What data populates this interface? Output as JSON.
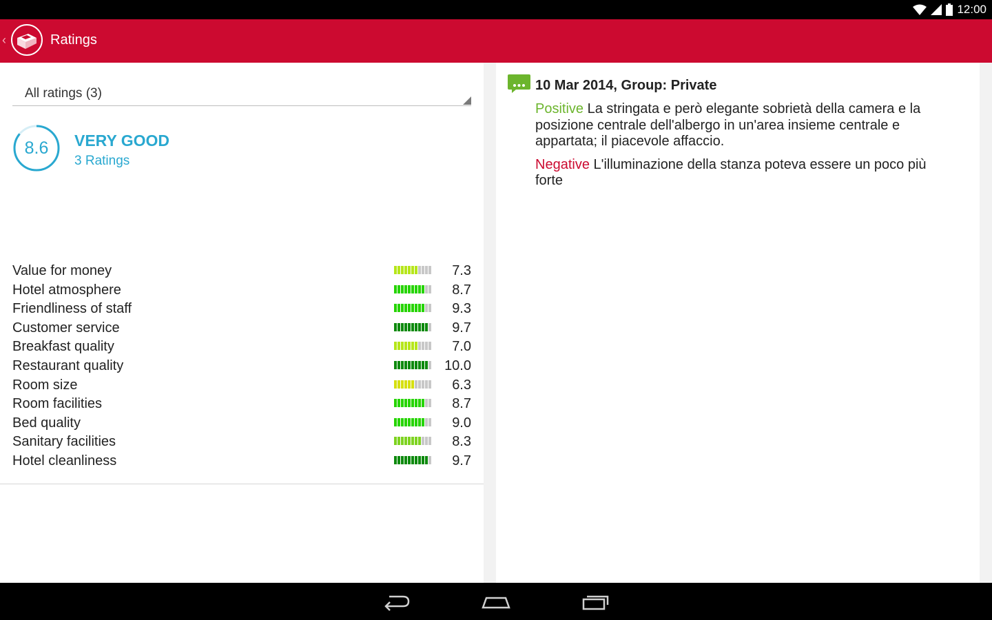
{
  "status_bar": {
    "time": "12:00"
  },
  "app_bar": {
    "title": "Ratings"
  },
  "filter": {
    "selected": "All ratings (3)"
  },
  "summary": {
    "score": "8.6",
    "score_fraction": 0.86,
    "verdict": "VERY GOOD",
    "count_label": "3 Ratings"
  },
  "criteria": [
    {
      "label": "Value for money",
      "value": "7.3"
    },
    {
      "label": "Hotel atmosphere",
      "value": "8.7"
    },
    {
      "label": "Friendliness of staff",
      "value": "9.3"
    },
    {
      "label": "Customer service",
      "value": "9.7"
    },
    {
      "label": "Breakfast quality",
      "value": "7.0"
    },
    {
      "label": "Restaurant quality",
      "value": "10.0"
    },
    {
      "label": "Room size",
      "value": "6.3"
    },
    {
      "label": "Room facilities",
      "value": "8.7"
    },
    {
      "label": "Bed quality",
      "value": "9.0"
    },
    {
      "label": "Sanitary facilities",
      "value": "8.3"
    },
    {
      "label": "Hotel cleanliness",
      "value": "9.7"
    }
  ],
  "review": {
    "header": "10 Mar 2014, Group: Private",
    "positive_label": "Positive",
    "positive_text": "La stringata e però elegante sobrietà della camera e la posizione centrale dell'albergo in un'area insieme centrale e appartata; il piacevole affaccio.",
    "negative_label": "Negative",
    "negative_text": "L'illuminazione della stanza poteva essere un poco più forte"
  },
  "colors": {
    "brand_red": "#cc0a30",
    "score_blue": "#29a8d0",
    "positive_green": "#6cb52d"
  }
}
